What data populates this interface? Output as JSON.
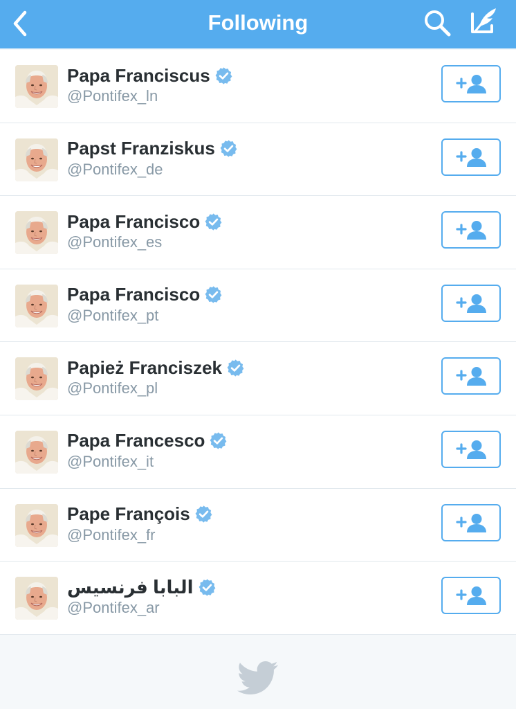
{
  "header": {
    "title": "Following",
    "back_icon": "chevron-left-icon",
    "search_icon": "search-icon",
    "compose_icon": "compose-icon",
    "background": "#55acee"
  },
  "accounts": [
    {
      "name": "Papa Franciscus",
      "handle": "@Pontifex_ln",
      "verified": true
    },
    {
      "name": "Papst Franziskus",
      "handle": "@Pontifex_de",
      "verified": true
    },
    {
      "name": "Papa Francisco",
      "handle": "@Pontifex_es",
      "verified": true
    },
    {
      "name": "Papa Francisco",
      "handle": "@Pontifex_pt",
      "verified": true
    },
    {
      "name": "Papież Franciszek",
      "handle": "@Pontifex_pl",
      "verified": true
    },
    {
      "name": "Papa Francesco",
      "handle": "@Pontifex_it",
      "verified": true
    },
    {
      "name": "Pape François",
      "handle": "@Pontifex_fr",
      "verified": true
    },
    {
      "name": "البابا فرنسيس",
      "handle": "@Pontifex_ar",
      "verified": true
    }
  ],
  "follow_button_icon": "add-user-icon",
  "footer": {
    "icon": "twitter-bird-icon"
  },
  "colors": {
    "accent": "#55acee",
    "name_text": "#292f33",
    "handle_text": "#8899a6",
    "divider": "#e1e8ed",
    "footer_background": "#f5f8fa"
  }
}
